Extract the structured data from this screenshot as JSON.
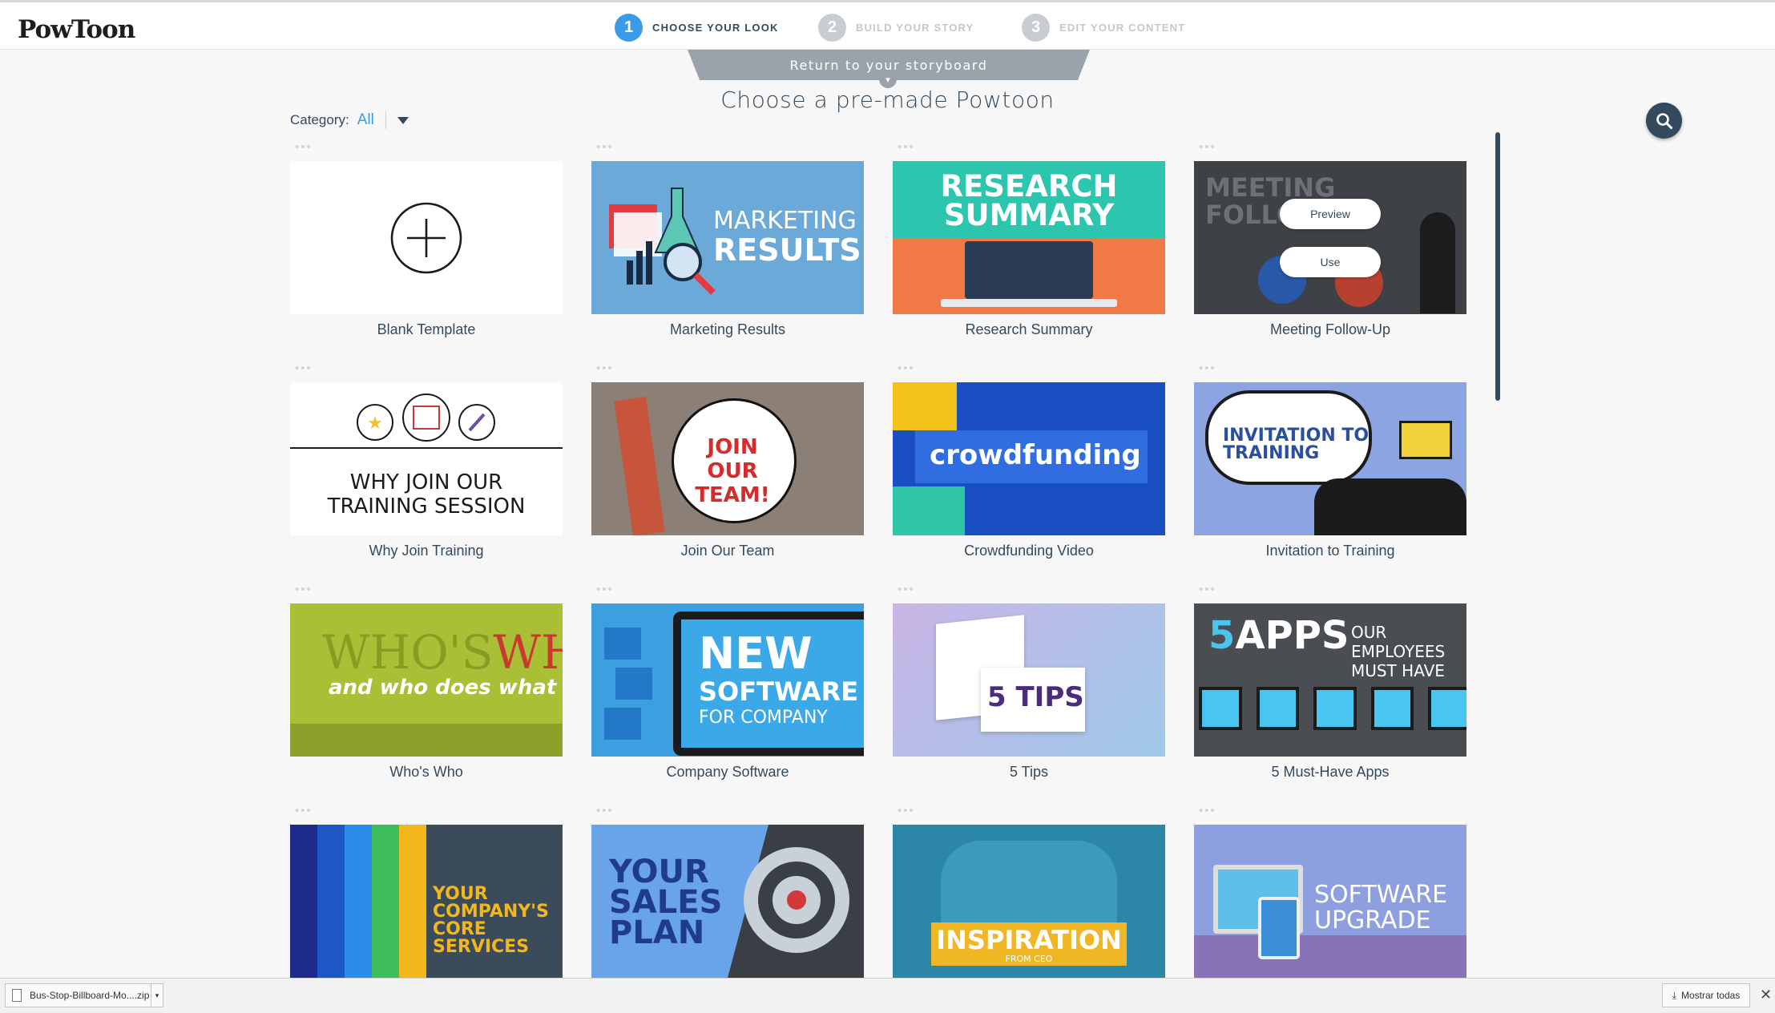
{
  "app": {
    "logo": "PowToon"
  },
  "steps": [
    {
      "num": "1",
      "label": "CHOOSE YOUR LOOK",
      "state": "active"
    },
    {
      "num": "2",
      "label": "BUILD YOUR STORY",
      "state": "inactive"
    },
    {
      "num": "3",
      "label": "EDIT YOUR CONTENT",
      "state": "inactive"
    }
  ],
  "return_tab": {
    "label": "Return to your storyboard",
    "arrow": "▾"
  },
  "heading": "Choose a pre-made Powtoon",
  "category": {
    "label": "Category:",
    "value": "All"
  },
  "card_dots": "•••",
  "overlay": {
    "preview": "Preview",
    "use": "Use"
  },
  "templates": [
    {
      "title": "Blank Template",
      "thumb_text": ""
    },
    {
      "title": "Marketing Results",
      "thumb_text": "MARKETING RESULTS"
    },
    {
      "title": "Research Summary",
      "thumb_text": "RESEARCH SUMMARY"
    },
    {
      "title": "Meeting Follow-Up",
      "thumb_text": "MEETING FOLLO"
    },
    {
      "title": "Why Join Training",
      "thumb_text": "WHY JOIN OUR TRAINING SESSION"
    },
    {
      "title": "Join Our Team",
      "thumb_text": "JOIN OUR TEAM!"
    },
    {
      "title": "Crowdfunding Video",
      "thumb_text": "crowdfunding"
    },
    {
      "title": "Invitation to Training",
      "thumb_text": "INVITATION TO TRAINING"
    },
    {
      "title": "Who's Who",
      "thumb_text": "WHO'S WHO and who does what"
    },
    {
      "title": "Company Software",
      "thumb_text": "NEW SOFTWARE FOR COMPANY"
    },
    {
      "title": "5 Tips",
      "thumb_text": "5 TIPS"
    },
    {
      "title": "5 Must-Have Apps",
      "thumb_text": "5 APPS OUR EMPLOYEES MUST HAVE"
    },
    {
      "title": "",
      "thumb_text": "YOUR COMPANY'S CORE SERVICES"
    },
    {
      "title": "",
      "thumb_text": "YOUR SALES PLAN"
    },
    {
      "title": "",
      "thumb_text": "INSPIRATION FROM CEO"
    },
    {
      "title": "",
      "thumb_text": "SOFTWARE UPGRADE"
    }
  ],
  "download_bar": {
    "file": "Bus-Stop-Billboard-Mo....zip",
    "show_all": "Mostrar todas"
  }
}
